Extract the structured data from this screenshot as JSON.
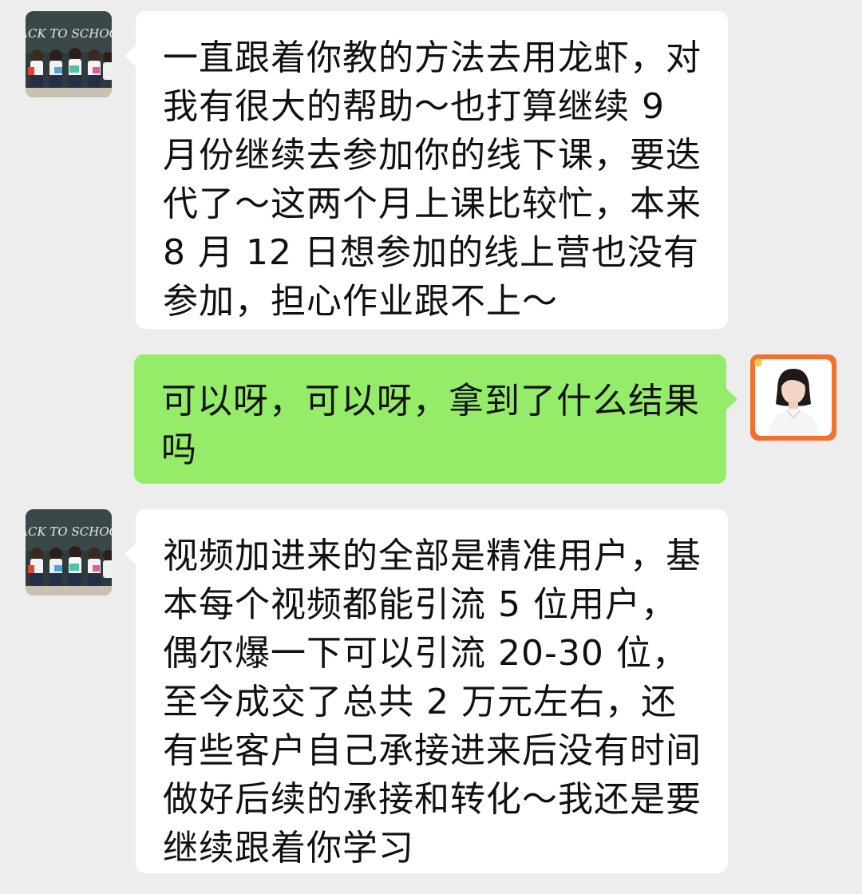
{
  "chat": {
    "messages": [
      {
        "sender": "contact",
        "text": "一直跟着你教的方法去用龙虾，对我有很大的帮助～也打算继续 9 月份继续去参加你的线下课，要迭代了～这两个月上课比较忙，本来 8 月 12 日想参加的线上营也没有参加，担心作业跟不上～"
      },
      {
        "sender": "self",
        "text": "可以呀，可以呀，拿到了什么结果吗"
      },
      {
        "sender": "contact",
        "text": "视频加进来的全部是精准用户，基本每个视频都能引流 5 位用户，偶尔爆一下可以引流 20-30 位，至今成交了总共 2 万元左右，还有些客户自己承接进来后没有时间做好后续的承接和转化～我还是要继续跟着你学习"
      }
    ],
    "contact_avatar": {
      "icon": "back-to-school-photo-icon",
      "caption": "BACK TO SCHOOL"
    },
    "self_avatar": {
      "icon": "woman-portrait-icon"
    },
    "colors": {
      "background": "#ededed",
      "incoming_bubble": "#ffffff",
      "outgoing_bubble": "#95ec69",
      "self_avatar_bg": "#f2712e"
    }
  }
}
